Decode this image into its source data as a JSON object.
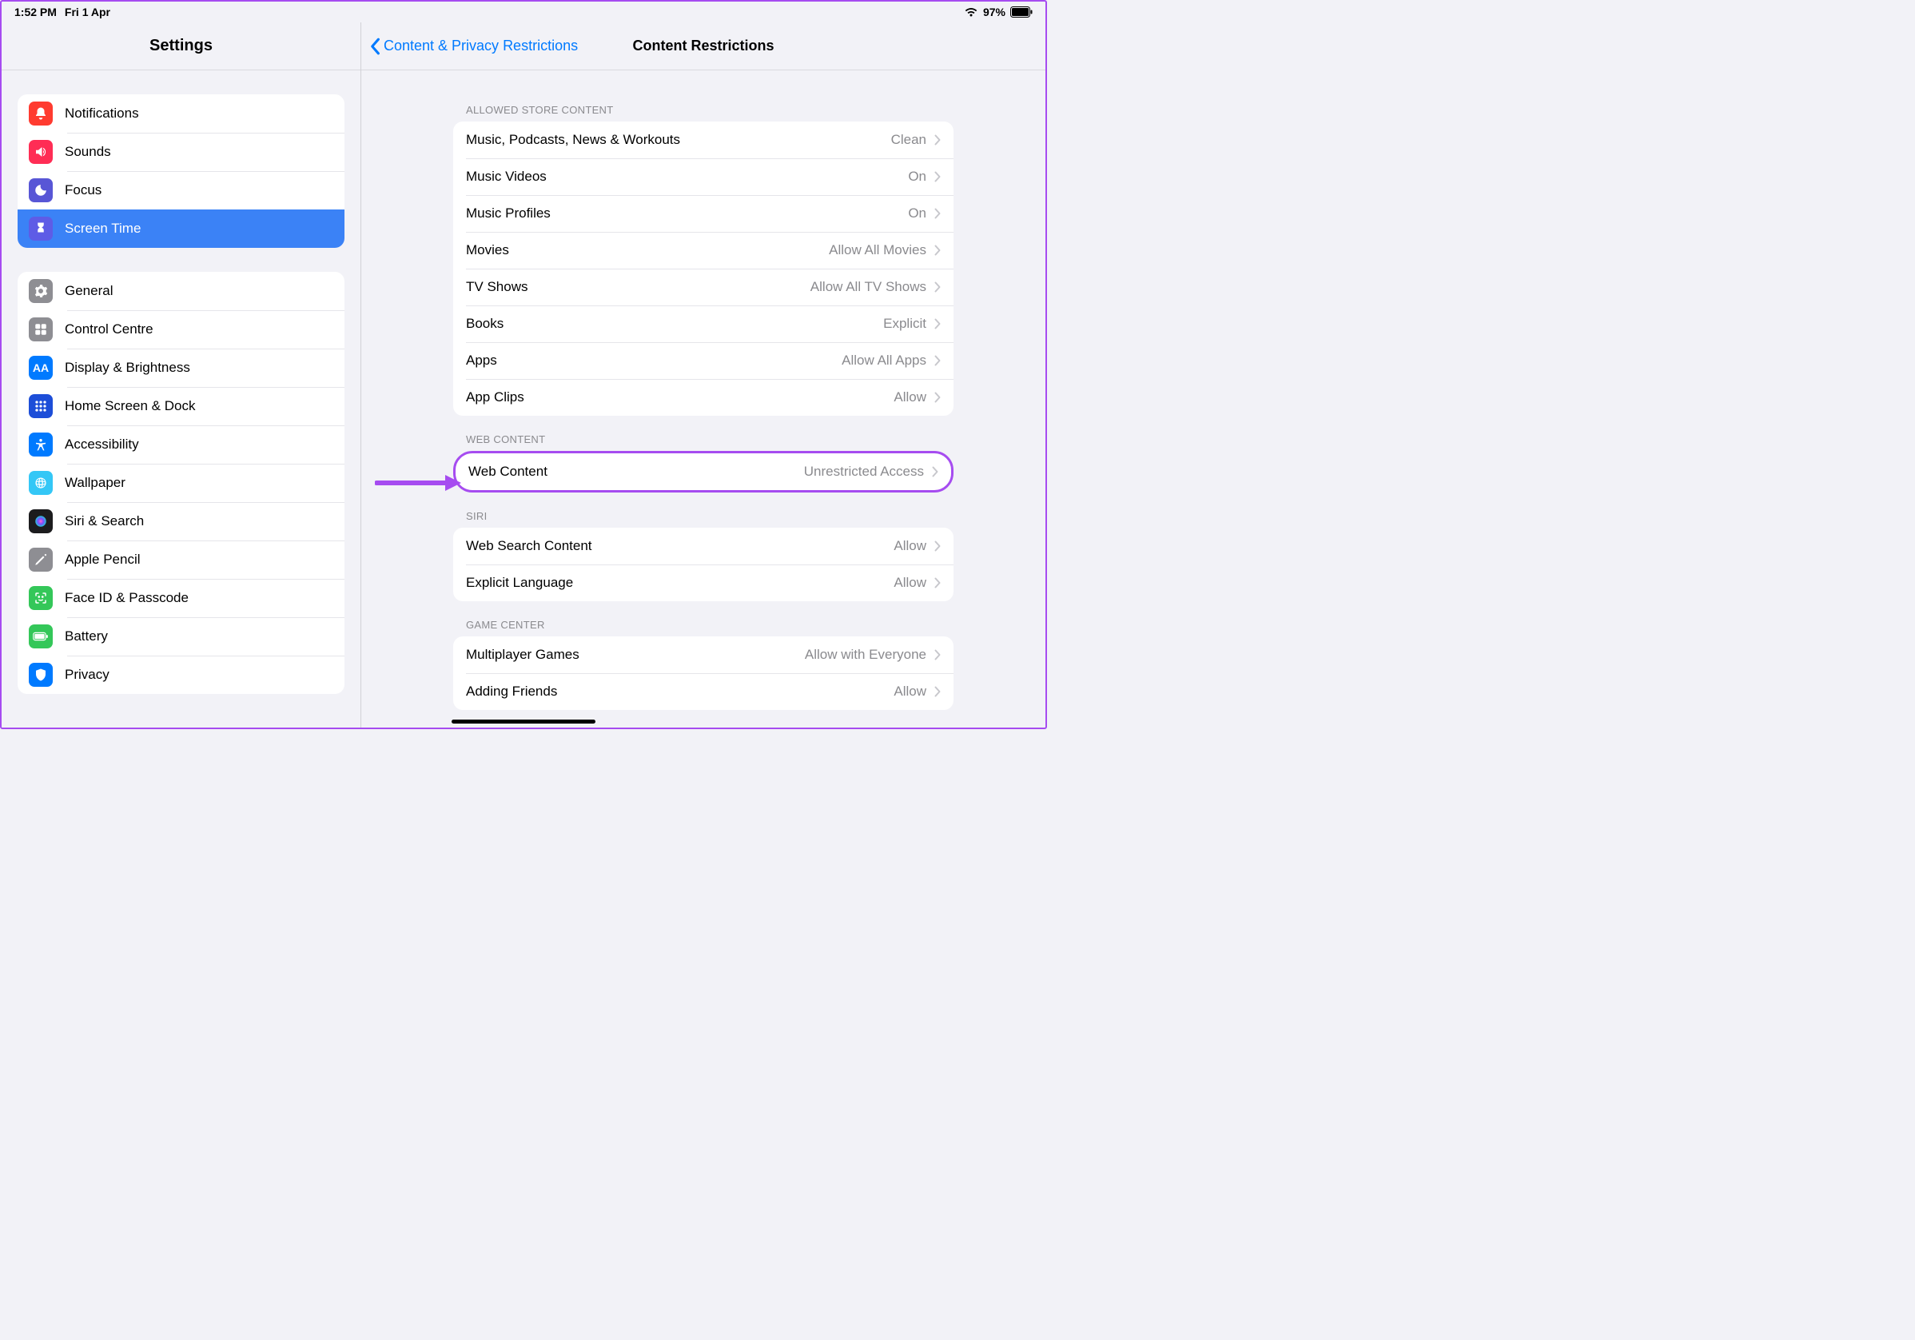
{
  "status": {
    "time": "1:52 PM",
    "date": "Fri 1 Apr",
    "battery_pct": "97%"
  },
  "sidebar": {
    "title": "Settings",
    "group1": [
      {
        "label": "Notifications",
        "icon": "notifications"
      },
      {
        "label": "Sounds",
        "icon": "sounds"
      },
      {
        "label": "Focus",
        "icon": "focus"
      },
      {
        "label": "Screen Time",
        "icon": "screentime",
        "selected": true
      }
    ],
    "group2": [
      {
        "label": "General",
        "icon": "general"
      },
      {
        "label": "Control Centre",
        "icon": "controlcentre"
      },
      {
        "label": "Display & Brightness",
        "icon": "display"
      },
      {
        "label": "Home Screen & Dock",
        "icon": "homescreen"
      },
      {
        "label": "Accessibility",
        "icon": "accessibility"
      },
      {
        "label": "Wallpaper",
        "icon": "wallpaper"
      },
      {
        "label": "Siri & Search",
        "icon": "siri"
      },
      {
        "label": "Apple Pencil",
        "icon": "pencil"
      },
      {
        "label": "Face ID & Passcode",
        "icon": "faceid"
      },
      {
        "label": "Battery",
        "icon": "battery"
      },
      {
        "label": "Privacy",
        "icon": "privacy"
      }
    ]
  },
  "pane": {
    "back_label": "Content & Privacy Restrictions",
    "title": "Content Restrictions",
    "sections": [
      {
        "header": "ALLOWED STORE CONTENT",
        "rows": [
          {
            "label": "Music, Podcasts, News & Workouts",
            "value": "Clean"
          },
          {
            "label": "Music Videos",
            "value": "On"
          },
          {
            "label": "Music Profiles",
            "value": "On"
          },
          {
            "label": "Movies",
            "value": "Allow All Movies"
          },
          {
            "label": "TV Shows",
            "value": "Allow All TV Shows"
          },
          {
            "label": "Books",
            "value": "Explicit"
          },
          {
            "label": "Apps",
            "value": "Allow All Apps"
          },
          {
            "label": "App Clips",
            "value": "Allow"
          }
        ]
      },
      {
        "header": "WEB CONTENT",
        "highlighted": true,
        "rows": [
          {
            "label": "Web Content",
            "value": "Unrestricted Access"
          }
        ]
      },
      {
        "header": "SIRI",
        "rows": [
          {
            "label": "Web Search Content",
            "value": "Allow"
          },
          {
            "label": "Explicit Language",
            "value": "Allow"
          }
        ]
      },
      {
        "header": "GAME CENTER",
        "rows": [
          {
            "label": "Multiplayer Games",
            "value": "Allow with Everyone"
          },
          {
            "label": "Adding Friends",
            "value": "Allow"
          }
        ]
      }
    ]
  }
}
